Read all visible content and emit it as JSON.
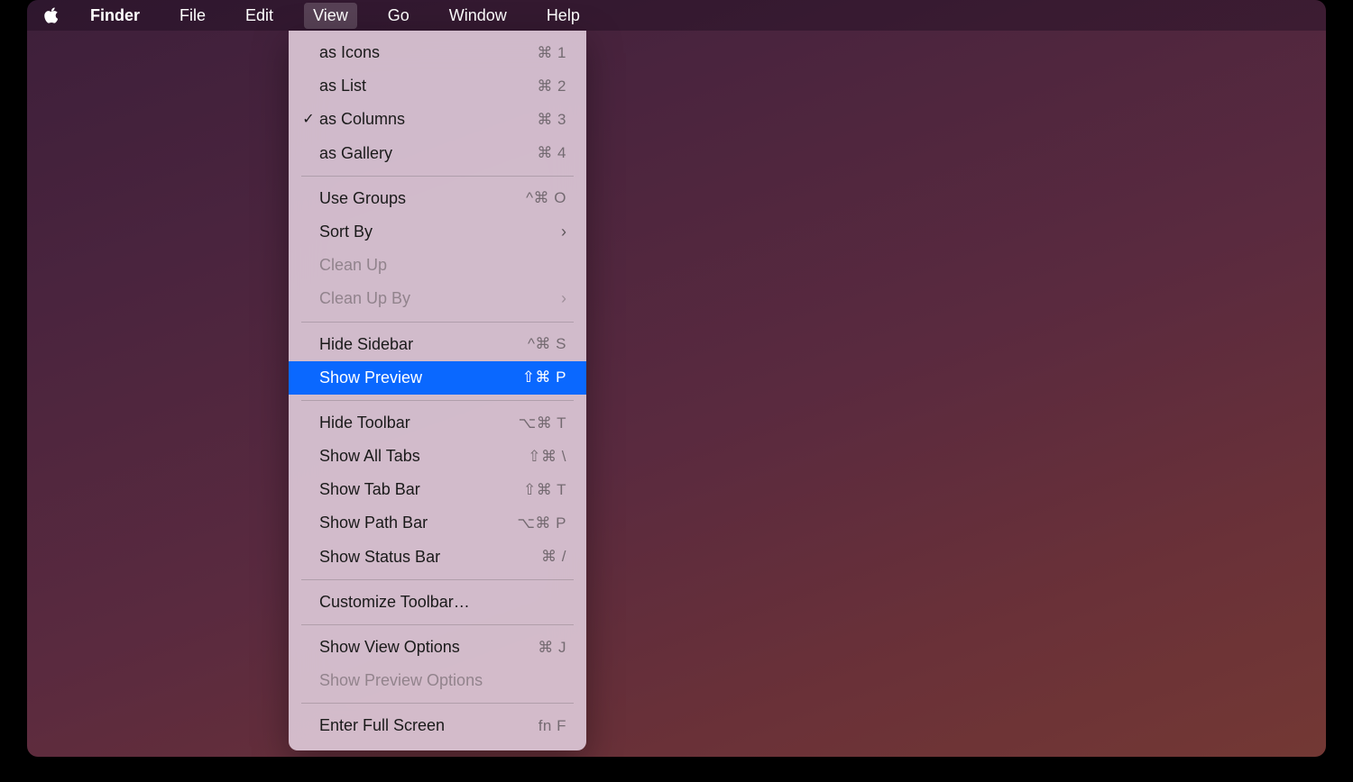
{
  "menubar": {
    "app_name": "Finder",
    "items": [
      {
        "label": "File"
      },
      {
        "label": "Edit"
      },
      {
        "label": "View",
        "active": true
      },
      {
        "label": "Go"
      },
      {
        "label": "Window"
      },
      {
        "label": "Help"
      }
    ]
  },
  "dropdown": {
    "items": [
      {
        "type": "item",
        "label": "as Icons",
        "shortcut": "⌘ 1"
      },
      {
        "type": "item",
        "label": "as List",
        "shortcut": "⌘ 2"
      },
      {
        "type": "item",
        "label": "as Columns",
        "shortcut": "⌘ 3",
        "checked": true
      },
      {
        "type": "item",
        "label": "as Gallery",
        "shortcut": "⌘ 4"
      },
      {
        "type": "separator"
      },
      {
        "type": "item",
        "label": "Use Groups",
        "shortcut": "^⌘ O"
      },
      {
        "type": "item",
        "label": "Sort By",
        "submenu": true
      },
      {
        "type": "item",
        "label": "Clean Up",
        "disabled": true
      },
      {
        "type": "item",
        "label": "Clean Up By",
        "submenu": true,
        "disabled": true
      },
      {
        "type": "separator"
      },
      {
        "type": "item",
        "label": "Hide Sidebar",
        "shortcut": "^⌘ S"
      },
      {
        "type": "item",
        "label": "Show Preview",
        "shortcut": "⇧⌘ P",
        "highlighted": true
      },
      {
        "type": "separator"
      },
      {
        "type": "item",
        "label": "Hide Toolbar",
        "shortcut": "⌥⌘ T"
      },
      {
        "type": "item",
        "label": "Show All Tabs",
        "shortcut": "⇧⌘ \\"
      },
      {
        "type": "item",
        "label": "Show Tab Bar",
        "shortcut": "⇧⌘ T"
      },
      {
        "type": "item",
        "label": "Show Path Bar",
        "shortcut": "⌥⌘ P"
      },
      {
        "type": "item",
        "label": "Show Status Bar",
        "shortcut": "⌘ /"
      },
      {
        "type": "separator"
      },
      {
        "type": "item",
        "label": "Customize Toolbar…"
      },
      {
        "type": "separator"
      },
      {
        "type": "item",
        "label": "Show View Options",
        "shortcut": "⌘ J"
      },
      {
        "type": "item",
        "label": "Show Preview Options",
        "disabled": true
      },
      {
        "type": "separator"
      },
      {
        "type": "item",
        "label": "Enter Full Screen",
        "shortcut": "fn F"
      }
    ]
  }
}
